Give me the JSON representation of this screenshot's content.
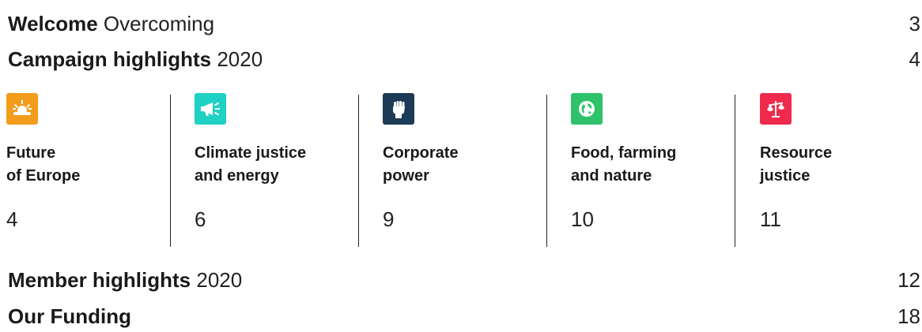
{
  "toc": [
    {
      "bold": "Welcome",
      "sub": "Overcoming",
      "page": "3"
    },
    {
      "bold": "Campaign highlights",
      "sub": "2020",
      "page": "4"
    },
    {
      "bold": "Member highlights",
      "sub": "2020",
      "page": "12"
    },
    {
      "bold": "Our Funding",
      "sub": "",
      "page": "18"
    }
  ],
  "topics": [
    {
      "label": "Future\nof Europe",
      "page": "4",
      "color": "#f39c1b",
      "icon": "sunrise-icon"
    },
    {
      "label": "Climate justice\nand energy",
      "page": "6",
      "color": "#1fd1c2",
      "icon": "megaphone-icon"
    },
    {
      "label": "Corporate\npower",
      "page": "9",
      "color": "#1d3a56",
      "icon": "fist-icon"
    },
    {
      "label": "Food, farming\nand nature",
      "page": "10",
      "color": "#2ec26a",
      "icon": "globe-icon"
    },
    {
      "label": "Resource\n justice",
      "page": "11",
      "color": "#ee2b4d",
      "icon": "scales-icon"
    }
  ]
}
